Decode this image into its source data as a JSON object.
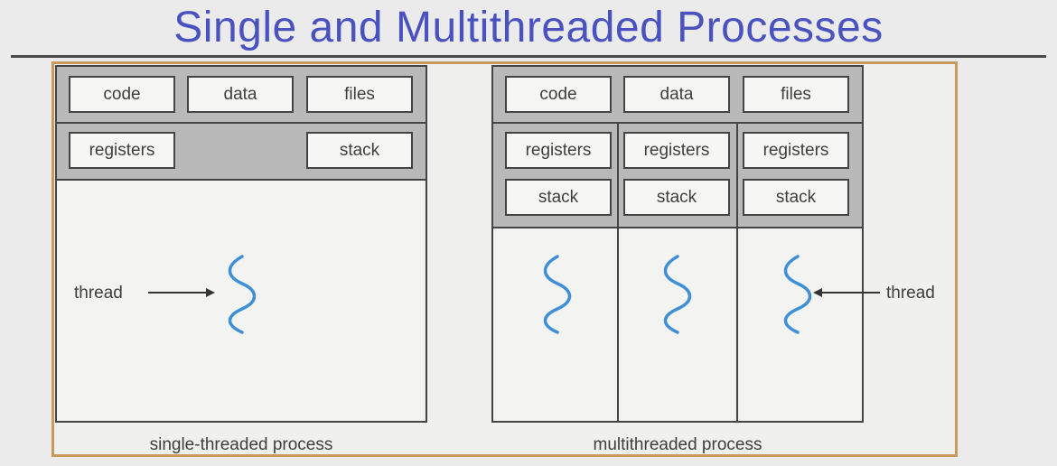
{
  "slide": {
    "title": "Single and Multithreaded Processes"
  },
  "single": {
    "boxes": {
      "code": "code",
      "data": "data",
      "files": "files",
      "registers": "registers",
      "stack": "stack"
    },
    "thread_label": "thread",
    "caption": "single-threaded process"
  },
  "multi": {
    "boxes": {
      "code": "code",
      "data": "data",
      "files": "files"
    },
    "threads": [
      {
        "registers": "registers",
        "stack": "stack"
      },
      {
        "registers": "registers",
        "stack": "stack"
      },
      {
        "registers": "registers",
        "stack": "stack"
      }
    ],
    "thread_label": "thread",
    "caption": "multithreaded process"
  },
  "colors": {
    "title": "#4a52c0",
    "thread_wave": "#3f8fd6",
    "frame": "#c79a5e",
    "band": "#b9b9b9"
  }
}
